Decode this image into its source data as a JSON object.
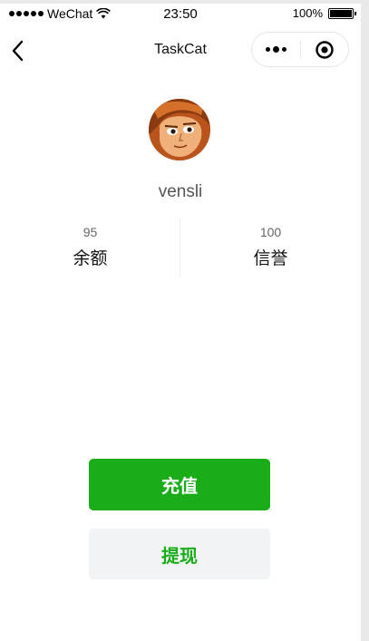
{
  "status_bar": {
    "carrier": "WeChat",
    "time": "23:50",
    "battery": "100%",
    "battery_level": 1.0
  },
  "nav": {
    "title": "TaskCat",
    "back_icon": "chevron-left-icon",
    "more_icon": "more-dots-icon",
    "close_icon": "target-circle-icon"
  },
  "profile": {
    "username": "vensli"
  },
  "stats": [
    {
      "value": "95",
      "label": "余额"
    },
    {
      "value": "100",
      "label": "信誉"
    }
  ],
  "actions": {
    "recharge_label": "充值",
    "withdraw_label": "提现"
  },
  "colors": {
    "accent": "#1aad19",
    "secondary_bg": "#f2f3f5"
  }
}
